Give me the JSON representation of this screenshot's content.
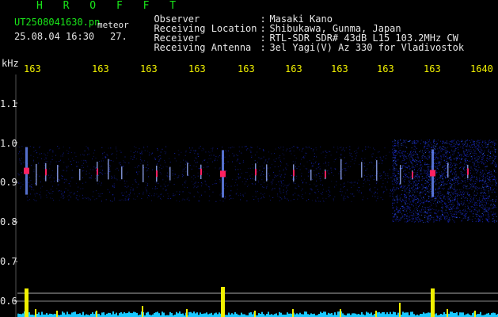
{
  "header": {
    "app_title": "H R O F F T",
    "filename": "UT2508041630.pn",
    "meteor_label": "meteor",
    "datetime": "25.08.04 16:30",
    "count": "27."
  },
  "station": [
    {
      "label": "Observer",
      "sep": ":",
      "value": "Masaki Kano"
    },
    {
      "label": "Receiving Location",
      "sep": ":",
      "value": "Shibukawa, Gunma, Japan"
    },
    {
      "label": "Receiver",
      "sep": ":",
      "value": "RTL-SDR SDR# 43dB L15 103.2MHz CW"
    },
    {
      "label": "Receiving Antenna",
      "sep": ":",
      "value": "3el Yagi(V) Az 330 for Vladivostok"
    }
  ],
  "axis": {
    "unit": "kHz",
    "x_ticks": [
      "163",
      "163",
      "163",
      "163",
      "163",
      "163",
      "163",
      "163",
      "163",
      "1640"
    ],
    "y_ticks": [
      "1.1",
      "1.0",
      "0.9",
      "0.8",
      "0.7",
      "0.6"
    ]
  },
  "colors": {
    "background": "#000000",
    "text": "#e6e6e6",
    "title_green": "#19e619",
    "tick_yellow": "#f0f000",
    "echo_red": "#ff2060",
    "noise_blue": "#1a2ad0",
    "level_cyan": "#19c8ff"
  }
}
